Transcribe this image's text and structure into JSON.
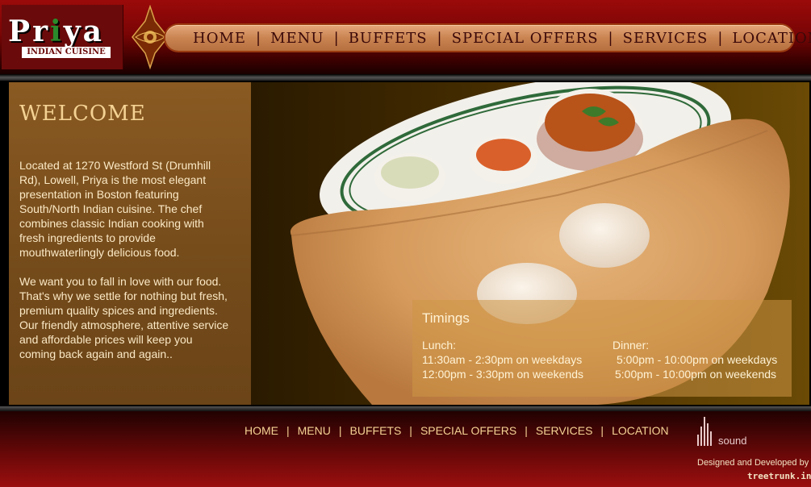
{
  "brand": {
    "name": "Priya",
    "subtitle": "INDIAN CUISINE"
  },
  "nav": {
    "items": [
      "HOME",
      "MENU",
      "BUFFETS",
      "SPECIAL OFFERS",
      "SERVICES",
      "LOCATION"
    ]
  },
  "welcome": {
    "title": "WELCOME",
    "paragraph1": "Located at 1270 Westford St (Drumhill Rd), Lowell, Priya is the most elegant presentation in Boston featuring South/North Indian cuisine. The chef combines classic Indian cooking with fresh ingredients to provide mouthwaterlingly delicious food.",
    "paragraph2": "We want you to fall in love with our food. That's why we settle for nothing but fresh, premium quality spices and ingredients. Our friendly atmosphere, attentive service and affordable prices will keep you coming back again and again.."
  },
  "timings": {
    "title": "Timings",
    "lunch": {
      "label": "Lunch:",
      "weekdays": "11:30am - 2:30pm on weekdays",
      "weekends": "12:00pm - 3:30pm on weekends"
    },
    "dinner": {
      "label": "Dinner:",
      "weekdays": "5:00pm - 10:00pm on weekdays",
      "weekends": "5:00pm - 10:00pm on weekends"
    }
  },
  "footer": {
    "nav": [
      "HOME",
      "MENU",
      "BUFFETS",
      "SPECIAL OFFERS",
      "SERVICES",
      "LOCATION"
    ],
    "sound_label": "sound",
    "credit": "Designed and Developed by",
    "credit_brand": "treetrunk.in"
  },
  "colors": {
    "header_red": "#9b0a0a",
    "nav_bar": "#c98452",
    "welcome_panel": "#8a5a22",
    "accent_text": "#f4d294"
  }
}
